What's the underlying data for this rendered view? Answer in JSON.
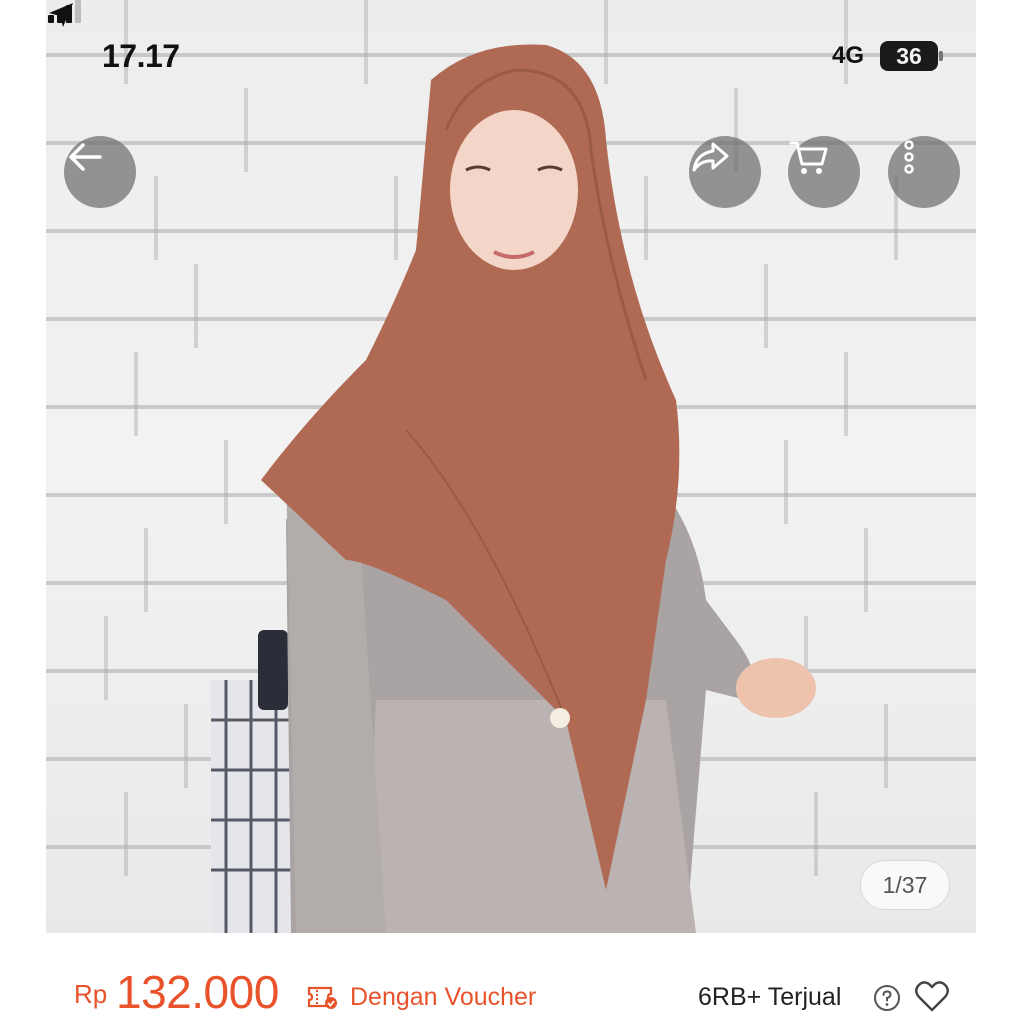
{
  "status_bar": {
    "time": "17.17",
    "network": "4G",
    "battery": "36",
    "icons": [
      "location-arrow-icon",
      "signal-icon"
    ]
  },
  "product": {
    "image_counter": "1/37",
    "image_alt": "hijab-model-photo"
  },
  "actions": {
    "icons": [
      "back-arrow-icon",
      "share-icon",
      "cart-icon",
      "more-icon"
    ]
  },
  "price": {
    "currency": "Rp",
    "value": "132.000",
    "voucher_label": "Dengan Voucher",
    "sold_label": "6RB+ Terjual"
  },
  "colors": {
    "accent": "#e8532b",
    "hijab": "#b06a53",
    "text": "#222222"
  }
}
